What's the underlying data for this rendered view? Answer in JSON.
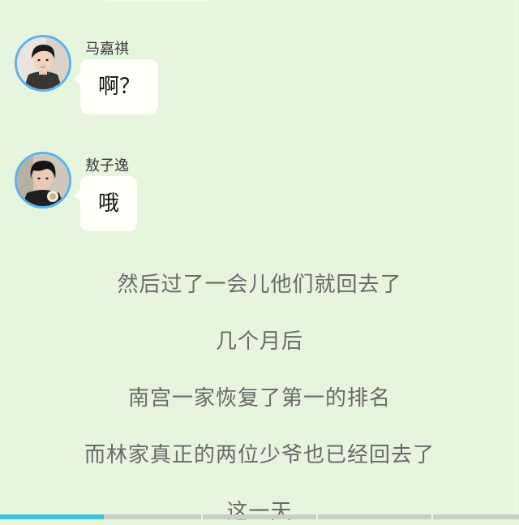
{
  "chat": {
    "messages": [
      {
        "sender": "马嘉祺",
        "text": "啊？"
      },
      {
        "sender": "敖子逸",
        "text": "哦"
      }
    ]
  },
  "narration": {
    "lines": [
      "然后过了一会儿他们就回去了",
      "几个月后",
      "南宫一家恢复了第一的排名",
      "而林家真正的两位少爷也已经回去了",
      "这一天"
    ]
  },
  "reading_progress": 0.2,
  "colors": {
    "background": "#e6f5dd",
    "avatar_ring": "#5cb1f0",
    "bubble": "#fdfff8",
    "progress": "#39c6d2"
  },
  "icons": {
    "avatar_1": "person-avatar",
    "avatar_2": "person-avatar"
  }
}
